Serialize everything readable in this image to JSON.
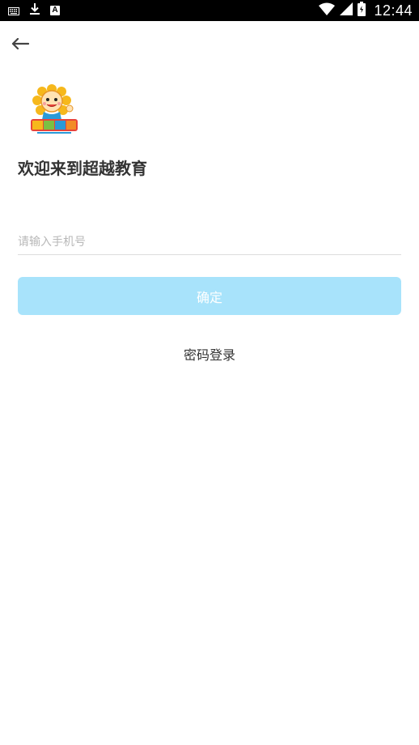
{
  "status_bar": {
    "time": "12:44",
    "badge_letter": "A",
    "icons": [
      "keyboard-icon",
      "download-icon",
      "a-badge-icon",
      "wifi-icon",
      "cell-signal-icon",
      "battery-icon"
    ]
  },
  "header": {
    "back_icon": "arrow-left-icon"
  },
  "brand": {
    "logo_text": "超越教育",
    "logo_colors": [
      "#f5b41a",
      "#e8443a",
      "#2a9ad8"
    ]
  },
  "welcome": {
    "title": "欢迎来到超越教育"
  },
  "form": {
    "phone_placeholder": "请输入手机号",
    "phone_value": "",
    "confirm_label": "确定",
    "password_login_label": "密码登录"
  },
  "colors": {
    "accent_disabled": "#a8e3fb",
    "title_text": "#333333",
    "placeholder": "#b8b8b8"
  }
}
